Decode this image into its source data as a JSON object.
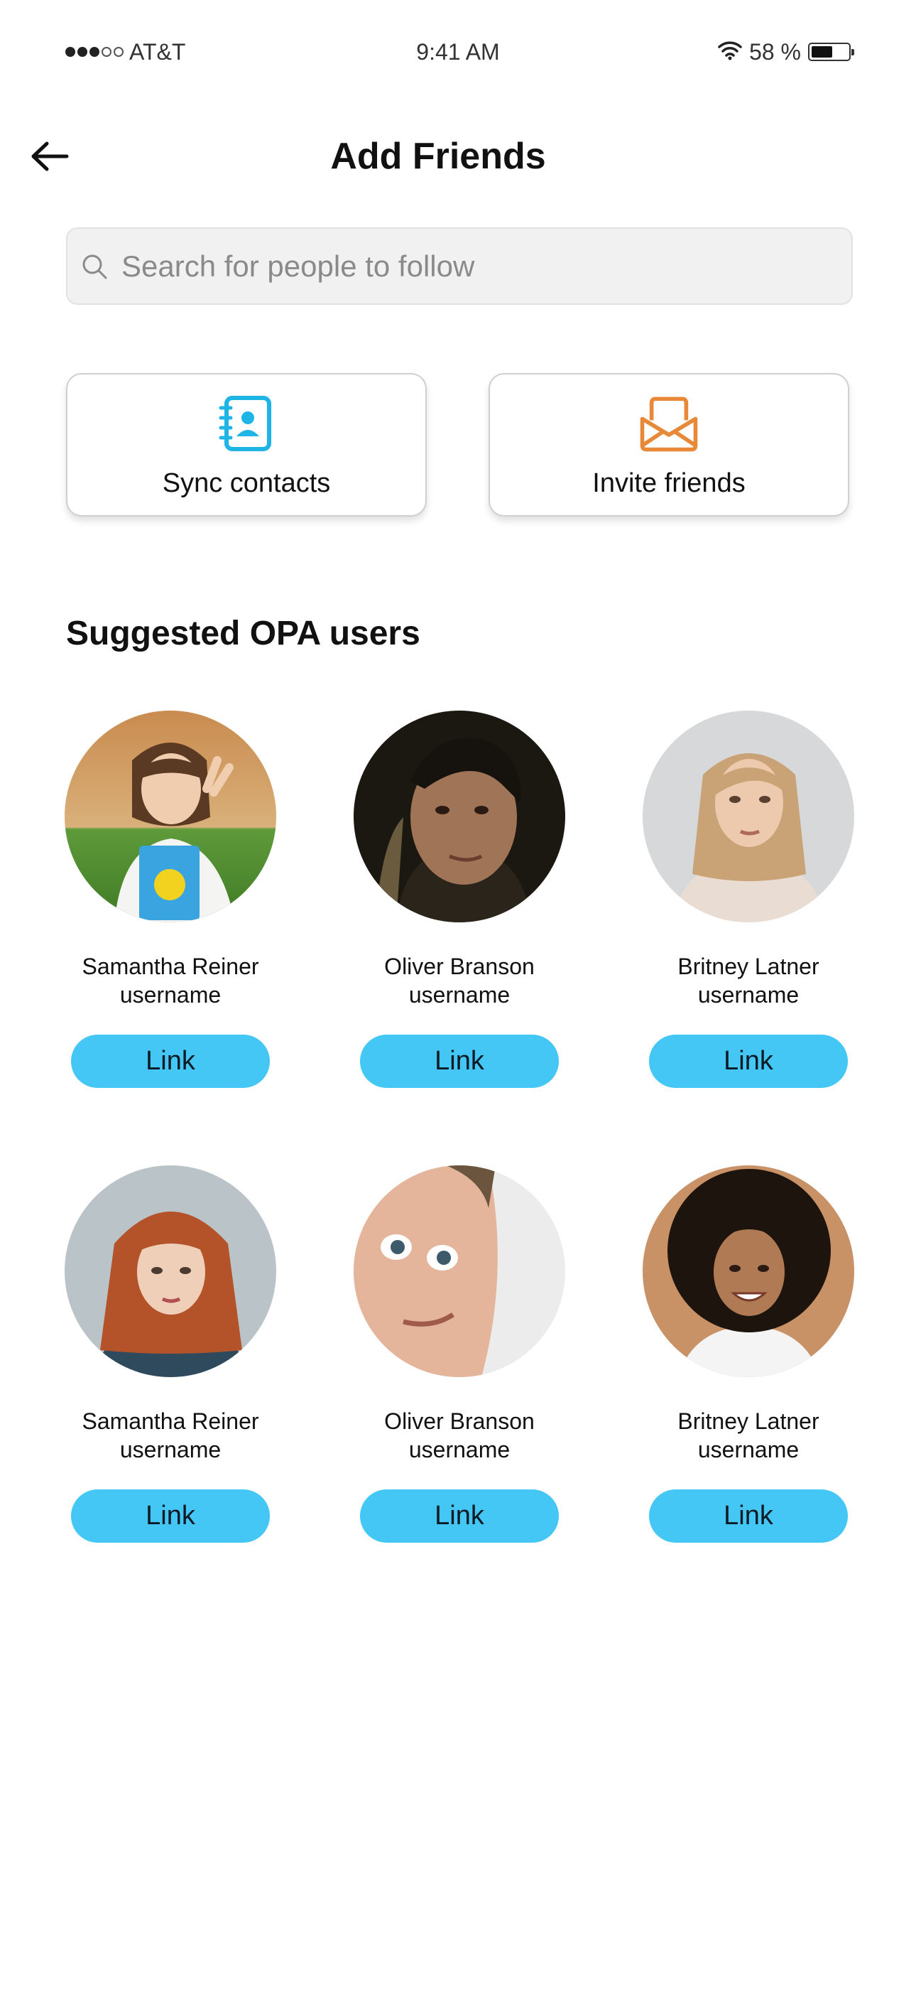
{
  "status_bar": {
    "carrier": "AT&T",
    "time": "9:41 AM",
    "battery_percent": "58 %",
    "battery_level": 0.58,
    "signal_bars_filled": 3,
    "signal_bars_total": 5
  },
  "header": {
    "title": "Add Friends",
    "back_icon": "arrow-left-icon"
  },
  "search": {
    "placeholder": "Search for people to follow",
    "value": "",
    "icon": "search-icon"
  },
  "actions": [
    {
      "label": "Sync contacts",
      "icon": "contact-book-icon",
      "color": "#1fb4e6"
    },
    {
      "label": "Invite friends",
      "icon": "envelope-open-icon",
      "color": "#e8893a"
    }
  ],
  "suggested": {
    "title": "Suggested  OPA users",
    "button_color": "#44c7f4",
    "users": [
      {
        "name": "Samantha Reiner",
        "username": "username",
        "button_label": "Link",
        "avatar": "photo-girl-smiling-outdoors"
      },
      {
        "name": "Oliver Branson",
        "username": "username",
        "button_label": "Link",
        "avatar": "photo-young-man-dark"
      },
      {
        "name": "Britney Latner",
        "username": "username",
        "button_label": "Link",
        "avatar": "photo-blonde-woman"
      },
      {
        "name": "Samantha Reiner",
        "username": "username",
        "button_label": "Link",
        "avatar": "photo-redhead-woman"
      },
      {
        "name": "Oliver Branson",
        "username": "username",
        "button_label": "Link",
        "avatar": "photo-man-closeup"
      },
      {
        "name": "Britney Latner",
        "username": "username",
        "button_label": "Link",
        "avatar": "photo-curly-hair-woman"
      }
    ]
  }
}
